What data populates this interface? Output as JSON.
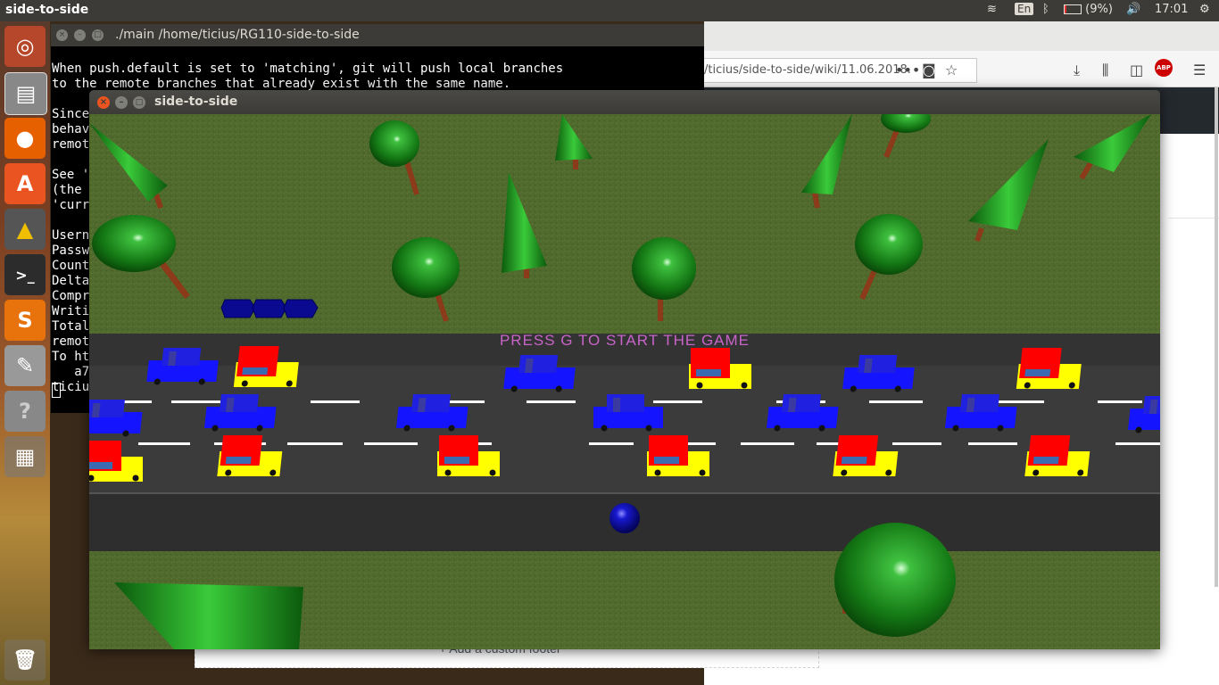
{
  "top_panel": {
    "app_title": "side-to-side",
    "keyboard_layout": "En",
    "battery": "(9%)",
    "clock": "17:01"
  },
  "launcher": {
    "items": [
      {
        "name": "ubuntu",
        "glyph": "◎"
      },
      {
        "name": "files",
        "glyph": "▤"
      },
      {
        "name": "firefox",
        "glyph": "●"
      },
      {
        "name": "software",
        "glyph": "A"
      },
      {
        "name": "geogebra",
        "glyph": "▲"
      },
      {
        "name": "terminal",
        "glyph": ">_"
      },
      {
        "name": "sublime",
        "glyph": "S"
      },
      {
        "name": "text-editor",
        "glyph": "✎"
      },
      {
        "name": "help",
        "glyph": "?"
      },
      {
        "name": "workspaces",
        "glyph": "▦"
      },
      {
        "name": "trash",
        "glyph": "🗑"
      }
    ]
  },
  "browser": {
    "url": "/ticius/side-to-side/wiki/11.06.2018.",
    "footer_link": "+ Add a custom footer"
  },
  "terminal": {
    "title": "./main  /home/ticius/RG110-side-to-side",
    "lines": [
      "",
      "When push.default is set to 'matching', git will push local branches",
      "to the remote branches that already exist with the same name.",
      "",
      "Since",
      "behav",
      "remot",
      "",
      "See '",
      "(the ",
      "'curr",
      "",
      "Usern",
      "Passw",
      "Count",
      "Delta",
      "Compr",
      "Writi",
      "Total",
      "remot",
      "To ht",
      "   a7",
      "ticiu"
    ]
  },
  "game": {
    "window_title": "side-to-side",
    "message": "PRESS  G  TO  START  THE  GAME",
    "lives": 3,
    "colors": {
      "grass": "#4f6a2c",
      "road": "#3a3a3a",
      "car_blue": "#1414ff",
      "car_red": "#ff0000",
      "car_yellow": "#ffff00",
      "tree_green": "#1fa01f",
      "trunk": "#8b3a1a",
      "ball": "#1010c0"
    }
  }
}
